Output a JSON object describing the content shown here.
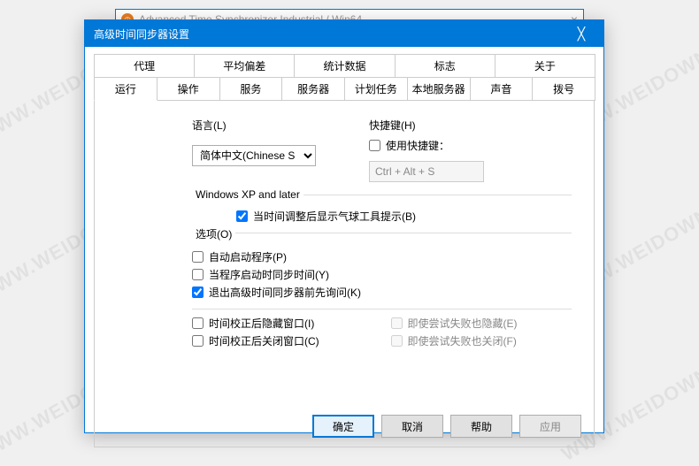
{
  "parent_window": {
    "title": "Advanced Time Synchronizer Industrial / Win64",
    "close": "×"
  },
  "dialog": {
    "title": "高级时间同步器设置",
    "close": "╳"
  },
  "tabs_row1": [
    "代理",
    "平均偏差",
    "统计数据",
    "标志",
    "关于"
  ],
  "tabs_row2": [
    "运行",
    "操作",
    "服务",
    "服务器",
    "计划任务",
    "本地服务器",
    "声音",
    "拨号"
  ],
  "active_tab": "运行",
  "language": {
    "label": "语言(L)",
    "value": "简体中文(Chinese S"
  },
  "hotkey": {
    "label": "快捷键(H)",
    "use_hotkey": "使用快捷键：",
    "use_hotkey_checked": false,
    "combo": "Ctrl + Alt + S"
  },
  "xp_group": {
    "title": "Windows XP and later",
    "balloon": "当时间调整后显示气球工具提示(B)",
    "balloon_checked": true
  },
  "options_group": {
    "title": "选项(O)",
    "autostart": "自动启动程序(P)",
    "autostart_checked": false,
    "sync_on_start": "当程序启动时同步时间(Y)",
    "sync_on_start_checked": false,
    "ask_before_exit": "退出高级时间同步器前先询问(K)",
    "ask_before_exit_checked": true
  },
  "window_group": {
    "hide_after_correct": "时间校正后隐藏窗口(I)",
    "hide_after_correct_checked": false,
    "hide_even_fail": "即使尝试失败也隐藏(E)",
    "hide_even_fail_checked": false,
    "close_after_correct": "时间校正后关闭窗口(C)",
    "close_after_correct_checked": false,
    "close_even_fail": "即使尝试失败也关闭(F)",
    "close_even_fail_checked": false
  },
  "buttons": {
    "ok": "确定",
    "cancel": "取消",
    "help": "帮助",
    "apply": "应用"
  },
  "watermark": "WWW.WEIDOWN.COM"
}
